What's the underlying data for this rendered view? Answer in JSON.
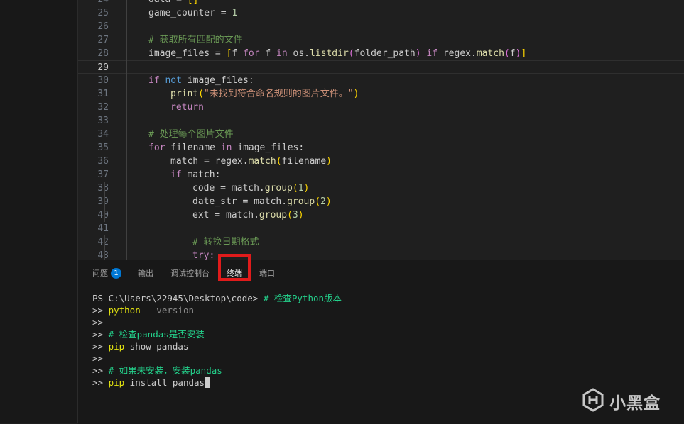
{
  "editor": {
    "lines": [
      {
        "num": "24",
        "indent": 1,
        "tokens": [
          [
            "data = ",
            "t-id"
          ],
          [
            "[]",
            "t-br1"
          ]
        ]
      },
      {
        "num": "25",
        "indent": 1,
        "tokens": [
          [
            "game_counter = ",
            "t-id"
          ],
          [
            "1",
            "t-num"
          ]
        ]
      },
      {
        "num": "26",
        "indent": 0,
        "tokens": []
      },
      {
        "num": "27",
        "indent": 1,
        "tokens": [
          [
            "# 获取所有匹配的文件",
            "t-cm"
          ]
        ]
      },
      {
        "num": "28",
        "indent": 1,
        "tokens": [
          [
            "image_files = ",
            "t-id"
          ],
          [
            "[",
            "t-br1"
          ],
          [
            "f ",
            "t-id"
          ],
          [
            "for",
            "t-kw"
          ],
          [
            " f ",
            "t-id"
          ],
          [
            "in",
            "t-kw"
          ],
          [
            " os.",
            "t-id"
          ],
          [
            "listdir",
            "t-fn"
          ],
          [
            "(",
            "t-br2"
          ],
          [
            "folder_path",
            "t-id"
          ],
          [
            ")",
            "t-br2"
          ],
          [
            " ",
            "t-id"
          ],
          [
            "if",
            "t-kw"
          ],
          [
            " regex.",
            "t-id"
          ],
          [
            "match",
            "t-fn"
          ],
          [
            "(",
            "t-br2"
          ],
          [
            "f",
            "t-id"
          ],
          [
            ")",
            "t-br2"
          ],
          [
            "]",
            "t-br1"
          ]
        ]
      },
      {
        "num": "29",
        "indent": 0,
        "tokens": [],
        "current": true
      },
      {
        "num": "30",
        "indent": 1,
        "tokens": [
          [
            "if",
            "t-kw"
          ],
          [
            " ",
            "t-id"
          ],
          [
            "not",
            "t-kw2"
          ],
          [
            " image_files:",
            "t-id"
          ]
        ]
      },
      {
        "num": "31",
        "indent": 2,
        "tokens": [
          [
            "print",
            "t-fn"
          ],
          [
            "(",
            "t-br1"
          ],
          [
            "\"未找到符合命名规则的图片文件。\"",
            "t-str"
          ],
          [
            ")",
            "t-br1"
          ]
        ]
      },
      {
        "num": "32",
        "indent": 2,
        "tokens": [
          [
            "return",
            "t-kw"
          ]
        ]
      },
      {
        "num": "33",
        "indent": 0,
        "tokens": []
      },
      {
        "num": "34",
        "indent": 1,
        "tokens": [
          [
            "# 处理每个图片文件",
            "t-cm"
          ]
        ]
      },
      {
        "num": "35",
        "indent": 1,
        "tokens": [
          [
            "for",
            "t-kw"
          ],
          [
            " filename ",
            "t-id"
          ],
          [
            "in",
            "t-kw"
          ],
          [
            " image_files:",
            "t-id"
          ]
        ]
      },
      {
        "num": "36",
        "indent": 2,
        "tokens": [
          [
            "match = regex.",
            "t-id"
          ],
          [
            "match",
            "t-fn"
          ],
          [
            "(",
            "t-br1"
          ],
          [
            "filename",
            "t-id"
          ],
          [
            ")",
            "t-br1"
          ]
        ]
      },
      {
        "num": "37",
        "indent": 2,
        "tokens": [
          [
            "if",
            "t-kw"
          ],
          [
            " match:",
            "t-id"
          ]
        ]
      },
      {
        "num": "38",
        "indent": 3,
        "tokens": [
          [
            "code = match.",
            "t-id"
          ],
          [
            "group",
            "t-fn"
          ],
          [
            "(",
            "t-br1"
          ],
          [
            "1",
            "t-num"
          ],
          [
            ")",
            "t-br1"
          ]
        ]
      },
      {
        "num": "39",
        "indent": 3,
        "tokens": [
          [
            "date_str = match.",
            "t-id"
          ],
          [
            "group",
            "t-fn"
          ],
          [
            "(",
            "t-br1"
          ],
          [
            "2",
            "t-num"
          ],
          [
            ")",
            "t-br1"
          ]
        ]
      },
      {
        "num": "40",
        "indent": 3,
        "tokens": [
          [
            "ext = match.",
            "t-id"
          ],
          [
            "group",
            "t-fn"
          ],
          [
            "(",
            "t-br1"
          ],
          [
            "3",
            "t-num"
          ],
          [
            ")",
            "t-br1"
          ]
        ]
      },
      {
        "num": "41",
        "indent": 0,
        "tokens": []
      },
      {
        "num": "42",
        "indent": 3,
        "tokens": [
          [
            "# 转换日期格式",
            "t-cm"
          ]
        ]
      },
      {
        "num": "43",
        "indent": 3,
        "tokens": [
          [
            "try:",
            "t-kw"
          ]
        ]
      }
    ]
  },
  "panel": {
    "tabs": [
      {
        "label": "问题",
        "badge": "1",
        "name": "tab-problems"
      },
      {
        "label": "输出",
        "name": "tab-output"
      },
      {
        "label": "调试控制台",
        "name": "tab-debug-console"
      },
      {
        "label": "终端",
        "name": "tab-terminal",
        "active": true
      },
      {
        "label": "端口",
        "name": "tab-ports"
      }
    ],
    "terminal_lines": [
      [
        [
          "PS C:\\Users\\22945\\Desktop\\code> ",
          "term-prompt"
        ],
        [
          "# 检查Python版本",
          "term-cm"
        ]
      ],
      [
        [
          ">> ",
          "term-prompt"
        ],
        [
          "python",
          "term-cmd"
        ],
        [
          " --version",
          "term-dim"
        ]
      ],
      [
        [
          ">>",
          "term-prompt"
        ]
      ],
      [
        [
          ">> ",
          "term-prompt"
        ],
        [
          "# 检查pandas是否安装",
          "term-cm"
        ]
      ],
      [
        [
          ">> ",
          "term-prompt"
        ],
        [
          "pip",
          "term-cmd"
        ],
        [
          " show pandas",
          "term-arg"
        ]
      ],
      [
        [
          ">>",
          "term-prompt"
        ]
      ],
      [
        [
          ">> ",
          "term-prompt"
        ],
        [
          "# 如果未安装，安装pandas",
          "term-cm"
        ]
      ],
      [
        [
          ">> ",
          "term-prompt"
        ],
        [
          "pip",
          "term-cmd"
        ],
        [
          " install pandas",
          "term-arg"
        ]
      ]
    ]
  },
  "watermark": {
    "text": "小黑盒",
    "icon": "heybox-logo-icon"
  },
  "colors": {
    "highlight": "#e01b1b",
    "accent": "#0078d4"
  }
}
